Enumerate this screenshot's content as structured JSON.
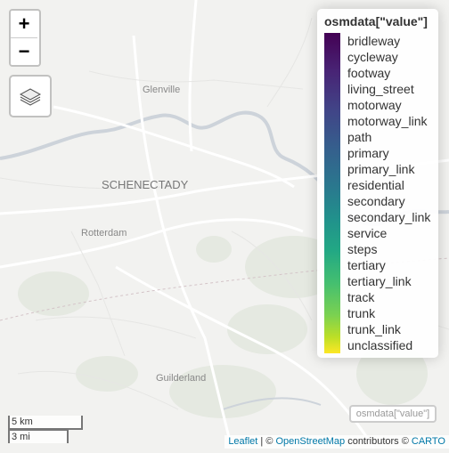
{
  "map": {
    "places": [
      {
        "name": "Glenville",
        "kind": "town"
      },
      {
        "name": "SCHENECTADY",
        "kind": "city"
      },
      {
        "name": "Rotterdam",
        "kind": "town"
      },
      {
        "name": "Guilderland",
        "kind": "town"
      }
    ],
    "river_color": "#cdd3da",
    "land_color": "#f2f2f0",
    "park_color": "#e4e8e0",
    "road_color": "#ffffff"
  },
  "controls": {
    "zoom_in_label": "+",
    "zoom_out_label": "−",
    "layers_icon": "layers-icon",
    "mini_control_label": "osmdata[\"value\"]"
  },
  "legend": {
    "title": "osmdata[\"value\"]",
    "palette": "viridis",
    "items": [
      "bridleway",
      "cycleway",
      "footway",
      "living_street",
      "motorway",
      "motorway_link",
      "path",
      "primary",
      "primary_link",
      "residential",
      "secondary",
      "secondary_link",
      "service",
      "steps",
      "tertiary",
      "tertiary_link",
      "track",
      "trunk",
      "trunk_link",
      "unclassified"
    ]
  },
  "scale": {
    "metric": "5 km",
    "imperial": "3 mi"
  },
  "attribution": {
    "leaflet": "Leaflet",
    "separator": " | © ",
    "osm": "OpenStreetMap",
    "middle": " contributors © ",
    "carto": "CARTO"
  }
}
